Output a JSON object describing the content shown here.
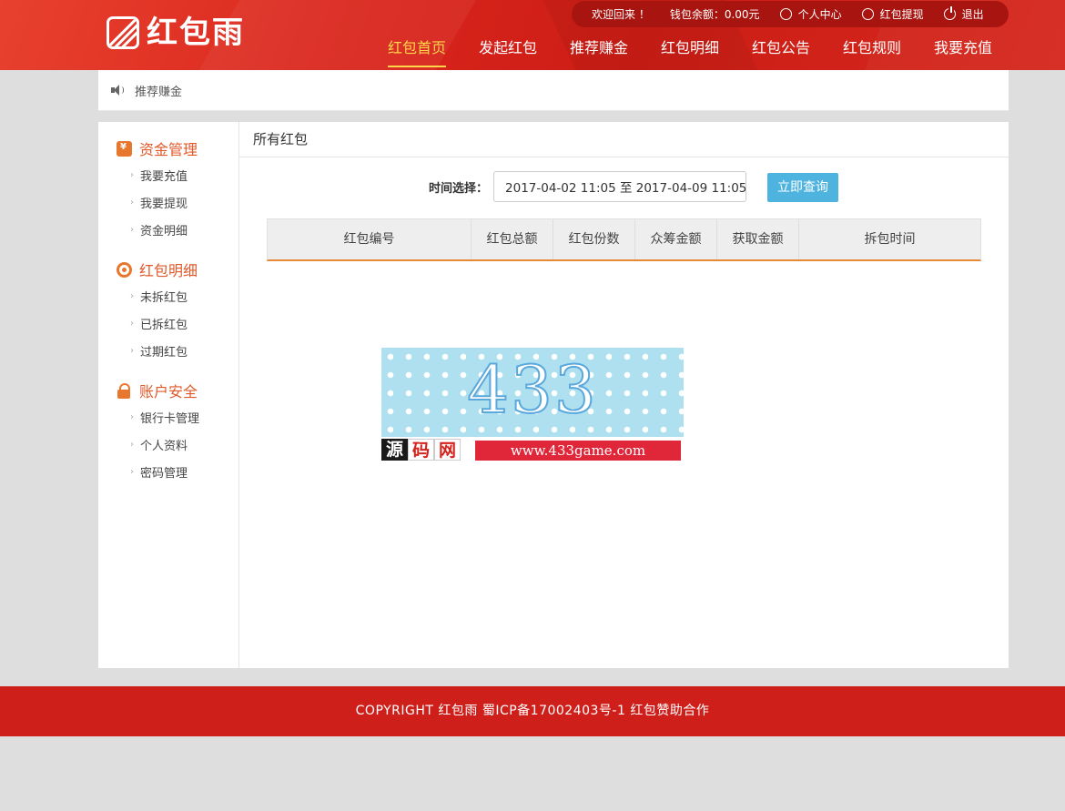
{
  "header": {
    "logo_text": "红包雨",
    "topbar": {
      "welcome": "欢迎回来 ！",
      "balance": "钱包余额：0.00元",
      "user_center": "个人中心",
      "withdraw": "红包提现",
      "logout": "退出"
    },
    "nav": [
      {
        "label": "红包首页",
        "active": true
      },
      {
        "label": "发起红包"
      },
      {
        "label": "推荐赚金"
      },
      {
        "label": "红包明细"
      },
      {
        "label": "红包公告"
      },
      {
        "label": "红包规则"
      },
      {
        "label": "我要充值"
      }
    ]
  },
  "breadcrumb": {
    "text": "推荐赚金"
  },
  "sidebar": {
    "groups": [
      {
        "title": "资金管理",
        "icon": "money-icon",
        "items": [
          "我要充值",
          "我要提现",
          "资金明细"
        ]
      },
      {
        "title": "红包明细",
        "icon": "target-icon",
        "items": [
          "未拆红包",
          "已拆红包",
          "过期红包"
        ]
      },
      {
        "title": "账户安全",
        "icon": "lock-icon",
        "items": [
          "银行卡管理",
          "个人资料",
          "密码管理"
        ]
      }
    ]
  },
  "content": {
    "title": "所有红包",
    "filter_label": "时间选择：",
    "date_range": "2017-04-02 11:05 至 2017-04-09 11:05",
    "query_button": "立即查询",
    "columns": [
      "红包编号",
      "红包总额",
      "红包份数",
      "众筹金额",
      "获取金额",
      "拆包时间"
    ],
    "rows": []
  },
  "watermark": {
    "number": "433",
    "source": [
      "源",
      "码",
      "网"
    ],
    "url": "www.433game.com"
  },
  "footer": {
    "text": "COPYRIGHT 红包雨 蜀ICP备17002403号-1 红包赞助合作"
  },
  "colors": {
    "brand_red": "#cf1f1b",
    "accent_orange": "#e0592a",
    "active_nav": "#ffd54a",
    "button_blue": "#4fb3e0"
  }
}
